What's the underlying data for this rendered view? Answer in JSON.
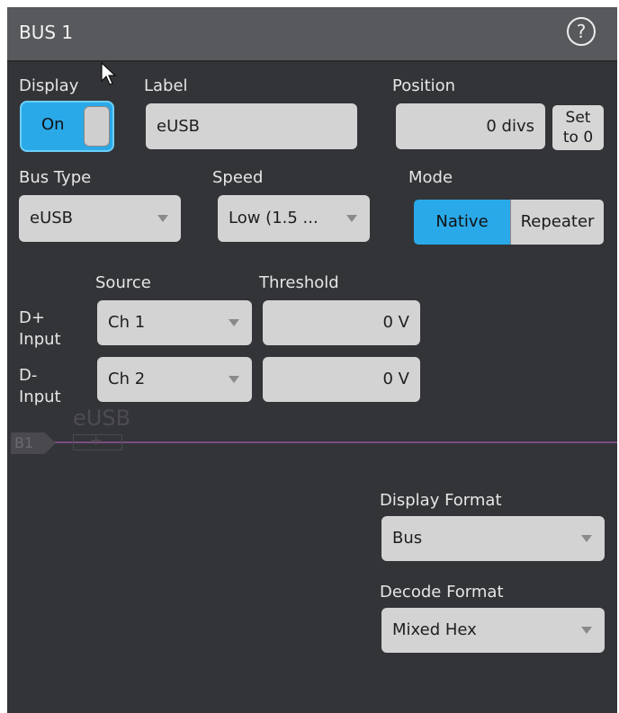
{
  "window": {
    "title": "BUS 1"
  },
  "help_icon": "question-circle-icon",
  "display": {
    "label": "Display",
    "toggle_value": "On"
  },
  "label_field": {
    "label": "Label",
    "value": "eUSB"
  },
  "position": {
    "label": "Position",
    "value": "0 divs",
    "set_button": [
      "Set",
      "to 0"
    ]
  },
  "bus_type": {
    "label": "Bus Type",
    "value": "eUSB"
  },
  "speed": {
    "label": "Speed",
    "value": "Low (1.5 ..."
  },
  "mode": {
    "label": "Mode",
    "options": [
      "Native",
      "Repeater"
    ],
    "selected": "Native"
  },
  "inputs": {
    "source_header": "Source",
    "threshold_header": "Threshold",
    "rows": [
      {
        "label_1": "D+",
        "label_2": "Input",
        "source": "Ch 1",
        "threshold": "0 V"
      },
      {
        "label_1": "D-",
        "label_2": "Input",
        "source": "Ch 2",
        "threshold": "0 V"
      }
    ]
  },
  "waveform": {
    "bus_tag": "B1",
    "ghost_label": "eUSB",
    "trace_color": "#7a4d82"
  },
  "display_format": {
    "label": "Display Format",
    "value": "Bus"
  },
  "decode_format": {
    "label": "Decode Format",
    "value": "Mixed Hex"
  },
  "colors": {
    "accent": "#2aa9e8",
    "panel_bg": "#333437",
    "titlebar_bg": "#58595c",
    "field_bg": "#d3d3d3"
  }
}
